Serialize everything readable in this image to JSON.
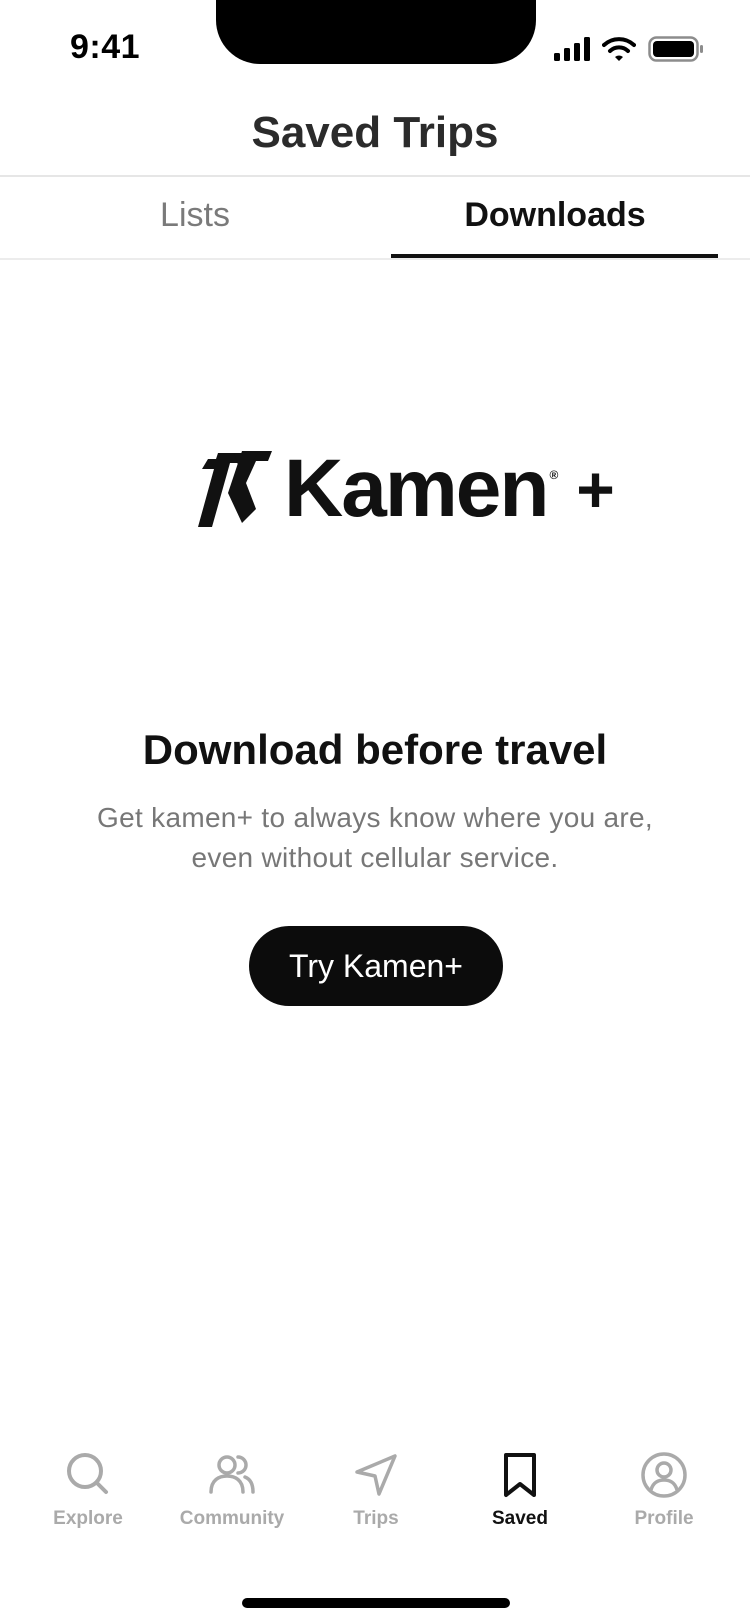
{
  "status_bar": {
    "time": "9:41"
  },
  "header": {
    "title": "Saved Trips"
  },
  "tabs": [
    {
      "label": "Lists",
      "active": false
    },
    {
      "label": "Downloads",
      "active": true
    }
  ],
  "logo": {
    "brand": "Kamen",
    "reg": "®",
    "plus": "+"
  },
  "empty_state": {
    "title": "Download before travel",
    "description": "Get kamen+ to always know where you are, even without cellular service.",
    "cta_label": "Try Kamen+"
  },
  "nav": [
    {
      "label": "Explore",
      "icon": "search-icon"
    },
    {
      "label": "Community",
      "icon": "users-icon"
    },
    {
      "label": "Trips",
      "icon": "navigation-icon"
    },
    {
      "label": "Saved",
      "icon": "bookmark-icon",
      "active": true
    },
    {
      "label": "Profile",
      "icon": "user-circle-icon"
    }
  ],
  "colors": {
    "accent": "#111111",
    "inactive": "#aaaaaa",
    "muted_text": "#777777"
  }
}
